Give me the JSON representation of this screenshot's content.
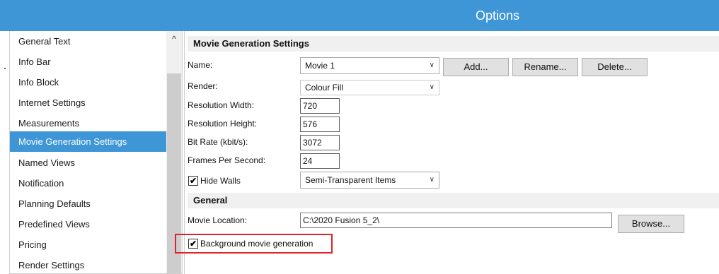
{
  "window": {
    "title": "Options"
  },
  "sidebar": {
    "scroll_up_glyph": "^",
    "items": [
      {
        "label": "General Text"
      },
      {
        "label": "Info Bar"
      },
      {
        "label": "Info Block"
      },
      {
        "label": "Internet Settings"
      },
      {
        "label": "Measurements"
      },
      {
        "label": "Movie Generation Settings",
        "selected": true
      },
      {
        "label": "Named Views"
      },
      {
        "label": "Notification"
      },
      {
        "label": "Planning Defaults"
      },
      {
        "label": "Predefined Views"
      },
      {
        "label": "Pricing"
      },
      {
        "label": "Render Settings"
      }
    ]
  },
  "movie_settings": {
    "section_title": "Movie Generation Settings",
    "name_label": "Name:",
    "name_value": "Movie 1",
    "add_button": "Add...",
    "rename_button": "Rename...",
    "delete_button": "Delete...",
    "render_label": "Render:",
    "render_value": "Colour Fill",
    "res_width_label": "Resolution Width:",
    "res_width_value": "720",
    "res_height_label": "Resolution Height:",
    "res_height_value": "576",
    "bitrate_label": "Bit Rate (kbit/s):",
    "bitrate_value": "3072",
    "fps_label": "Frames Per Second:",
    "fps_value": "24",
    "hide_walls_label": "Hide Walls",
    "hide_walls_checked": true,
    "hide_walls_mode": "Semi-Transparent Items"
  },
  "general": {
    "section_title": "General",
    "movie_location_label": "Movie Location:",
    "movie_location_value": "C:\\2020 Fusion 5_2\\",
    "browse_button": "Browse...",
    "background_gen_label": "Background movie generation",
    "background_gen_checked": true
  },
  "glyphs": {
    "dropdown_arrow": "∨",
    "check": "✔"
  },
  "colors": {
    "accent": "#3e96d6",
    "highlight_border": "#e0212b"
  }
}
